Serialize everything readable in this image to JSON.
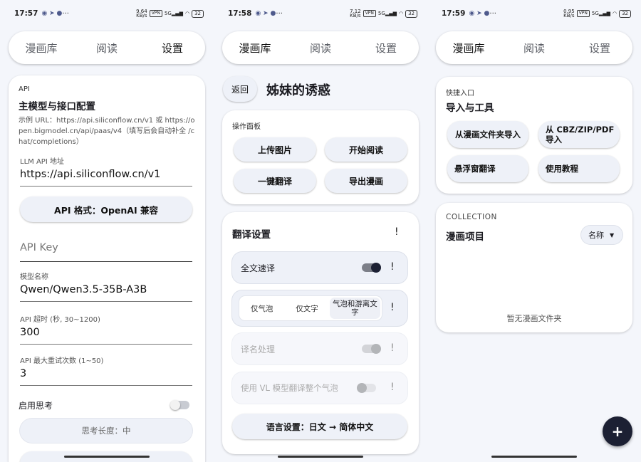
{
  "status": [
    {
      "time": "17:57",
      "net": "9.64\nKB/s"
    },
    {
      "time": "17:58",
      "net": "7.12\nKB/s"
    },
    {
      "time": "17:59",
      "net": "0.95\nKB/s"
    }
  ],
  "status_common": {
    "vpn": "VPN",
    "signal": "5G",
    "battery": "32",
    "more": "···"
  },
  "tabs": {
    "library": "漫画库",
    "read": "阅读",
    "settings": "设置"
  },
  "settings": {
    "section": "API",
    "title": "主模型与接口配置",
    "hint": "示例 URL：https://api.siliconflow.cn/v1 或 https://open.bigmodel.cn/api/paas/v4（填写后会自动补全 /chat/completions）",
    "llm_label": "LLM API 地址",
    "llm_value": "https://api.siliconflow.cn/v1",
    "format_button": "API 格式：OpenAI 兼容",
    "key_placeholder": "API Key",
    "model_label": "模型名称",
    "model_value": "Qwen/Qwen3.5-35B-A3B",
    "timeout_label": "API 超时 (秒, 30~1200)",
    "timeout_value": "300",
    "retry_label": "API 最大重试次数 (1~50)",
    "retry_value": "3",
    "thinking_label": "启用思考",
    "thinking_enabled": false,
    "thinking_length": "思考长度：中"
  },
  "reader": {
    "back": "返回",
    "title": "姊妹的诱惑",
    "panel_label": "操作面板",
    "upload": "上传图片",
    "start": "开始阅读",
    "translate_all": "一键翻译",
    "export": "导出漫画",
    "trans_title": "翻译设置",
    "bang": "!",
    "fast_label": "全文速译",
    "fast_enabled": true,
    "seg_bubble": "仅气泡",
    "seg_text": "仅文字",
    "seg_both": "气泡和游离文字",
    "name_label": "译名处理",
    "vl_label": "使用 VL 模型翻译整个气泡",
    "lang_button": "语言设置：日文 → 简体中文"
  },
  "library": {
    "quick_label": "快捷入口",
    "quick_title": "导入与工具",
    "import_folder": "从漫画文件夹导入",
    "import_archive": "从 CBZ/ZIP/PDF 导入",
    "float_translate": "悬浮窗翻译",
    "tutorial": "使用教程",
    "collection_label": "COLLECTION",
    "collection_title": "漫画项目",
    "sort": "名称",
    "empty": "暂无漫画文件夹",
    "fab": "+"
  },
  "colors": {
    "accent_dark": "#1c2033",
    "bg": "#f4f6fb",
    "pill": "#eef1f8"
  }
}
